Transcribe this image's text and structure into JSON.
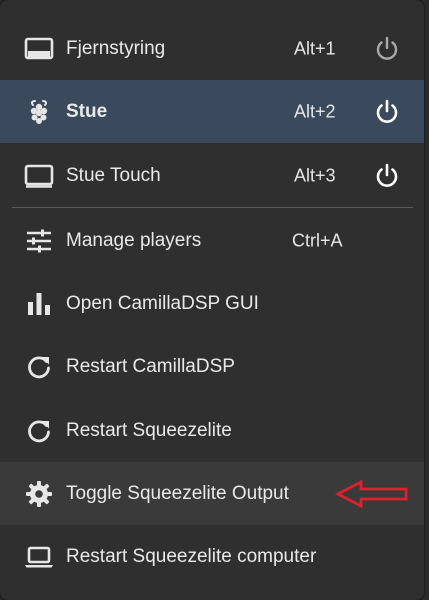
{
  "menu": {
    "players": [
      {
        "label": "Fjernstyring",
        "shortcut": "Alt+1",
        "icon": "display-icon",
        "power_icon": "power-icon",
        "state": "inactive"
      },
      {
        "label": "Stue",
        "shortcut": "Alt+2",
        "icon": "raspberry-pi-icon",
        "power_icon": "power-icon",
        "state": "active"
      },
      {
        "label": "Stue Touch",
        "shortcut": "Alt+3",
        "icon": "monitor-icon",
        "power_icon": "power-icon",
        "state": "inactive"
      }
    ],
    "actions": [
      {
        "label": "Manage players",
        "shortcut": "Ctrl+A",
        "icon": "sliders-icon"
      },
      {
        "label": "Open CamillaDSP GUI",
        "shortcut": "",
        "icon": "bar-chart-icon"
      },
      {
        "label": "Restart CamillaDSP",
        "shortcut": "",
        "icon": "refresh-icon"
      },
      {
        "label": "Restart Squeezelite",
        "shortcut": "",
        "icon": "refresh-icon"
      },
      {
        "label": "Toggle Squeezelite Output",
        "shortcut": "",
        "icon": "gear-icon"
      },
      {
        "label": "Restart Squeezelite computer",
        "shortcut": "",
        "icon": "laptop-icon"
      }
    ]
  },
  "colors": {
    "menu_background": "#2f2f2f",
    "active_background": "#3a4a5c",
    "hover_background": "#3a3a3a",
    "text": "#e9e9e9",
    "annotation_arrow": "#e0202a"
  }
}
